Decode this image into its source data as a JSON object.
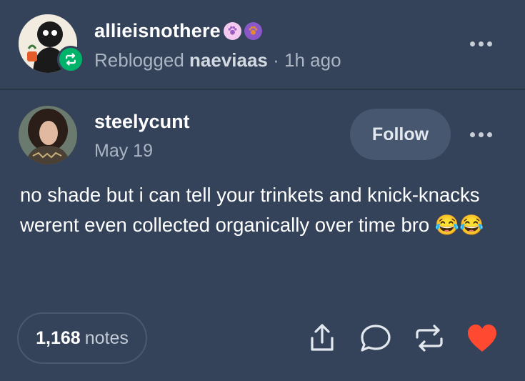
{
  "reblogger": {
    "username": "allieisnothere",
    "reblogged_label": "Reblogged",
    "reblogged_from": "naeviaas",
    "time": "· 1h ago",
    "badges": [
      "paw-badge-icon",
      "paw-badge-icon"
    ]
  },
  "post": {
    "author": "steelycunt",
    "date": "May 19",
    "follow_label": "Follow",
    "text": "no shade but i can tell your trinkets and knick-knacks werent even collected organically over time bro 😂😂",
    "notes_count": "1,168",
    "notes_label": "notes"
  },
  "icons": {
    "share": "share-icon",
    "reply": "reply-icon",
    "reblog": "reblog-icon",
    "like": "heart-icon"
  },
  "colors": {
    "background": "#34435a",
    "reblog_green": "#00b36b",
    "heart_red": "#ff4930"
  }
}
